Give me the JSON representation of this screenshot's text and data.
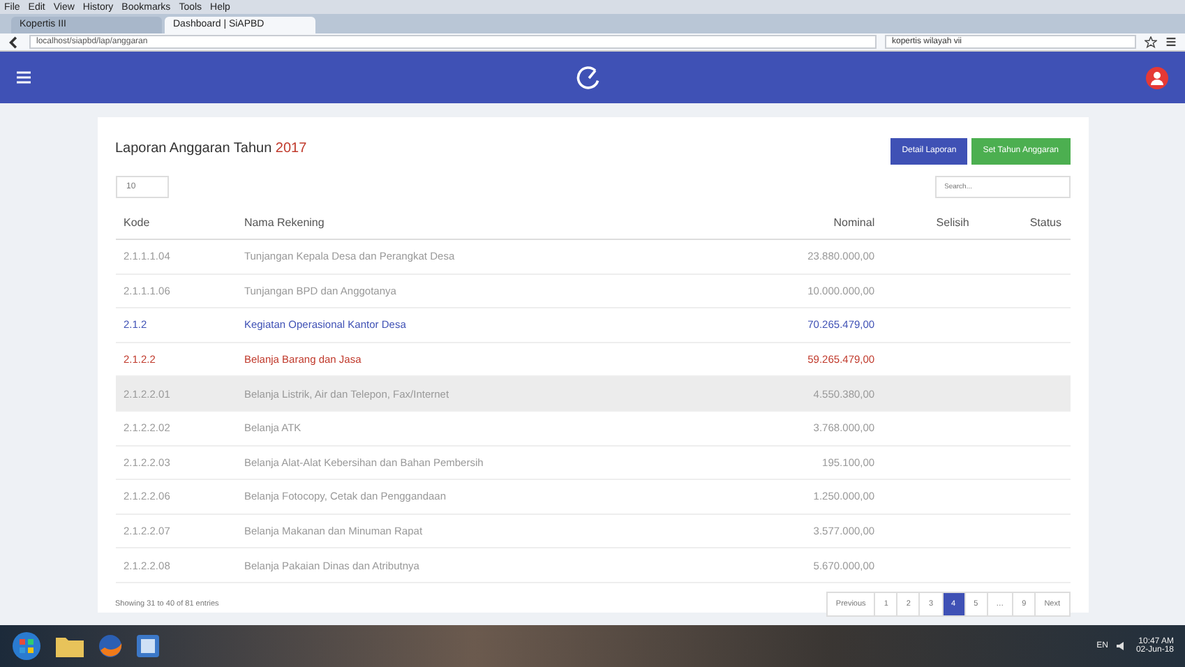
{
  "browser": {
    "menu": [
      "File",
      "Edit",
      "View",
      "History",
      "Bookmarks",
      "Tools",
      "Help"
    ],
    "tabs": [
      {
        "title": "Kopertis III",
        "selected": false
      },
      {
        "title": "Dashboard | SiAPBD",
        "selected": true
      }
    ],
    "url": "localhost/siapbd/lap/anggaran",
    "search": "kopertis wilayah vii"
  },
  "report": {
    "title": "Laporan Anggaran Tahun",
    "year": "2017",
    "buttons": [
      {
        "label": "Detail Laporan",
        "kind": "primary"
      },
      {
        "label": "Set Tahun Anggaran",
        "kind": "success"
      }
    ],
    "page_size": "10",
    "search_placeholder": "Search...",
    "columns": [
      {
        "label": "Kode"
      },
      {
        "label": "Nama Rekening"
      },
      {
        "label": "Nominal"
      },
      {
        "label": "Selisih"
      },
      {
        "label": "Status"
      }
    ],
    "rows": [
      {
        "kode": "2.1.1.1.04",
        "nama": "Tunjangan Kepala Desa dan Perangkat Desa",
        "nominal": "23.880.000,00",
        "kind": "item",
        "highlighted": false
      },
      {
        "kode": "2.1.1.1.06",
        "nama": "Tunjangan BPD dan Anggotanya",
        "nominal": "10.000.000,00",
        "kind": "item",
        "highlighted": false
      },
      {
        "kode": "2.1.2",
        "nama": "Kegiatan Operasional Kantor Desa",
        "nominal": "70.265.479,00",
        "kind": "group",
        "highlighted": false
      },
      {
        "kode": "2.1.2.2",
        "nama": "Belanja Barang dan Jasa",
        "nominal": "59.265.479,00",
        "kind": "subgroup",
        "highlighted": false
      },
      {
        "kode": "2.1.2.2.01",
        "nama": "Belanja Listrik, Air dan Telepon, Fax/Internet",
        "nominal": "4.550.380,00",
        "kind": "item",
        "highlighted": true
      },
      {
        "kode": "2.1.2.2.02",
        "nama": "Belanja ATK",
        "nominal": "3.768.000,00",
        "kind": "item",
        "highlighted": false
      },
      {
        "kode": "2.1.2.2.03",
        "nama": "Belanja Alat-Alat Kebersihan dan Bahan Pembersih",
        "nominal": "195.100,00",
        "kind": "item",
        "highlighted": false
      },
      {
        "kode": "2.1.2.2.06",
        "nama": "Belanja Fotocopy, Cetak dan Penggandaan",
        "nominal": "1.250.000,00",
        "kind": "item",
        "highlighted": false
      },
      {
        "kode": "2.1.2.2.07",
        "nama": "Belanja Makanan dan Minuman Rapat",
        "nominal": "3.577.000,00",
        "kind": "item",
        "highlighted": false
      },
      {
        "kode": "2.1.2.2.08",
        "nama": "Belanja Pakaian Dinas dan Atributnya",
        "nominal": "5.670.000,00",
        "kind": "item",
        "highlighted": false
      }
    ],
    "info": "Showing 31 to 40 of 81 entries",
    "pages": [
      {
        "label": "Previous",
        "selected": false
      },
      {
        "label": "1",
        "selected": false
      },
      {
        "label": "2",
        "selected": false
      },
      {
        "label": "3",
        "selected": false
      },
      {
        "label": "4",
        "selected": true
      },
      {
        "label": "5",
        "selected": false
      },
      {
        "label": "…",
        "selected": false
      },
      {
        "label": "9",
        "selected": false
      },
      {
        "label": "Next",
        "selected": false
      }
    ]
  },
  "taskbar": {
    "lang": "EN",
    "time": "10:47 AM",
    "date": "02-Jun-18"
  }
}
